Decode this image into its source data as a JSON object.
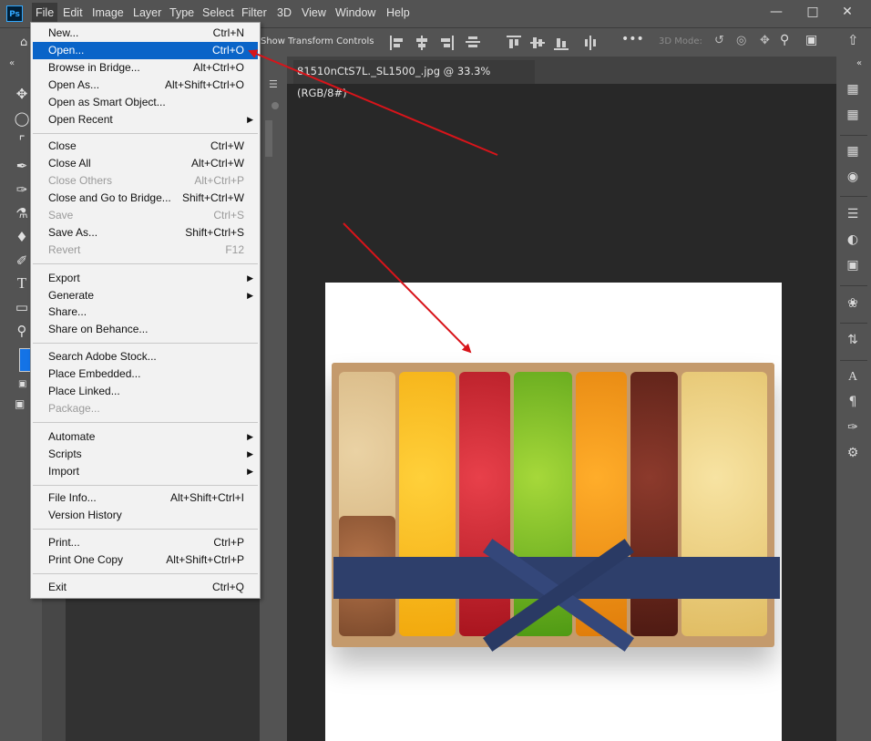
{
  "menubar": {
    "logo": "Ps",
    "items": [
      "File",
      "Edit",
      "Image",
      "Layer",
      "Type",
      "Select",
      "Filter",
      "3D",
      "View",
      "Window",
      "Help"
    ],
    "active": "File"
  },
  "options_bar": {
    "show_transform_label": "Show Transform Controls",
    "mode_3d_label": "3D Mode:"
  },
  "document": {
    "tab_title": "81510nCtS7L._SL1500_.jpg @ 33.3% (RGB/8#)"
  },
  "file_menu": {
    "groups": [
      [
        {
          "label": "New...",
          "shortcut": "Ctrl+N",
          "state": "enabled"
        },
        {
          "label": "Open...",
          "shortcut": "Ctrl+O",
          "state": "highlighted"
        },
        {
          "label": "Browse in Bridge...",
          "shortcut": "Alt+Ctrl+O",
          "state": "enabled"
        },
        {
          "label": "Open As...",
          "shortcut": "Alt+Shift+Ctrl+O",
          "state": "enabled"
        },
        {
          "label": "Open as Smart Object...",
          "shortcut": "",
          "state": "enabled"
        },
        {
          "label": "Open Recent",
          "shortcut": "",
          "state": "submenu"
        }
      ],
      [
        {
          "label": "Close",
          "shortcut": "Ctrl+W",
          "state": "enabled"
        },
        {
          "label": "Close All",
          "shortcut": "Alt+Ctrl+W",
          "state": "enabled"
        },
        {
          "label": "Close Others",
          "shortcut": "Alt+Ctrl+P",
          "state": "disabled"
        },
        {
          "label": "Close and Go to Bridge...",
          "shortcut": "Shift+Ctrl+W",
          "state": "enabled"
        },
        {
          "label": "Save",
          "shortcut": "Ctrl+S",
          "state": "disabled"
        },
        {
          "label": "Save As...",
          "shortcut": "Shift+Ctrl+S",
          "state": "enabled"
        },
        {
          "label": "Revert",
          "shortcut": "F12",
          "state": "disabled"
        }
      ],
      [
        {
          "label": "Export",
          "shortcut": "",
          "state": "submenu"
        },
        {
          "label": "Generate",
          "shortcut": "",
          "state": "submenu"
        },
        {
          "label": "Share...",
          "shortcut": "",
          "state": "enabled"
        },
        {
          "label": "Share on Behance...",
          "shortcut": "",
          "state": "enabled"
        }
      ],
      [
        {
          "label": "Search Adobe Stock...",
          "shortcut": "",
          "state": "enabled"
        },
        {
          "label": "Place Embedded...",
          "shortcut": "",
          "state": "enabled"
        },
        {
          "label": "Place Linked...",
          "shortcut": "",
          "state": "enabled"
        },
        {
          "label": "Package...",
          "shortcut": "",
          "state": "disabled"
        }
      ],
      [
        {
          "label": "Automate",
          "shortcut": "",
          "state": "submenu"
        },
        {
          "label": "Scripts",
          "shortcut": "",
          "state": "submenu"
        },
        {
          "label": "Import",
          "shortcut": "",
          "state": "submenu"
        }
      ],
      [
        {
          "label": "File Info...",
          "shortcut": "Alt+Shift+Ctrl+I",
          "state": "enabled"
        },
        {
          "label": "Version History",
          "shortcut": "",
          "state": "enabled"
        }
      ],
      [
        {
          "label": "Print...",
          "shortcut": "Ctrl+P",
          "state": "enabled"
        },
        {
          "label": "Print One Copy",
          "shortcut": "Alt+Shift+Ctrl+P",
          "state": "enabled"
        }
      ],
      [
        {
          "label": "Exit",
          "shortcut": "Ctrl+Q",
          "state": "enabled"
        }
      ]
    ]
  },
  "colors": {
    "highlight": "#0a64c8",
    "arrow": "#d8141a",
    "menubar_bg": "#535353",
    "workspace_bg": "#282828"
  },
  "icons": {
    "left_tools": [
      "move-tool-icon",
      "lasso-tool-icon",
      "crop-tool-icon",
      "eyedropper-tool-icon",
      "brush-tool-icon",
      "clone-stamp-tool-icon",
      "paint-bucket-tool-icon",
      "pen-tool-icon",
      "type-tool-icon",
      "rectangle-tool-icon",
      "zoom-tool-icon"
    ],
    "right_panels": [
      "color-panel-icon",
      "swatches-panel-icon",
      "layers-panel-icon",
      "channels-panel-icon",
      "adjustments-panel-icon",
      "properties-panel-icon",
      "libraries-panel-icon",
      "history-panel-icon",
      "actions-panel-icon",
      "character-panel-icon",
      "paragraph-panel-icon",
      "brushes-panel-icon",
      "brush-settings-panel-icon"
    ]
  }
}
